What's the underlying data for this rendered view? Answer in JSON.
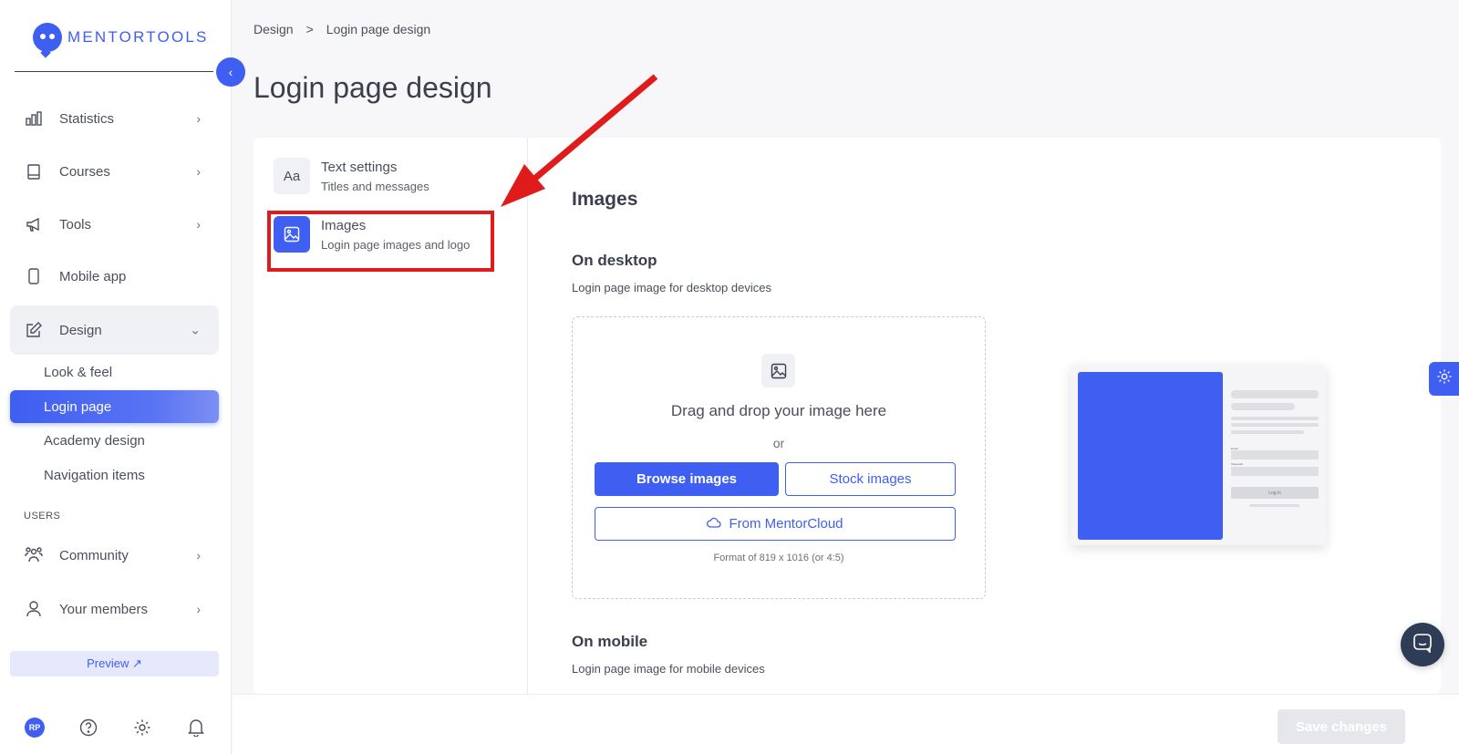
{
  "brand": {
    "name": "MENTORTOOLS",
    "accent": "#3f5ef2",
    "highlight": "#e01b1b"
  },
  "sidebar": {
    "items": [
      {
        "label": "Statistics",
        "icon": "bar-chart-icon"
      },
      {
        "label": "Courses",
        "icon": "book-icon"
      },
      {
        "label": "Tools",
        "icon": "megaphone-icon"
      },
      {
        "label": "Mobile app",
        "icon": "phone-icon"
      },
      {
        "label": "Design",
        "icon": "edit-icon"
      }
    ],
    "design_sub": [
      {
        "label": "Look & feel"
      },
      {
        "label": "Login page"
      },
      {
        "label": "Academy design"
      },
      {
        "label": "Navigation items"
      }
    ],
    "users_label": "USERS",
    "user_items": [
      {
        "label": "Community",
        "icon": "community-icon"
      },
      {
        "label": "Your members",
        "icon": "user-icon"
      }
    ],
    "preview_label": "Preview ↗",
    "avatar_initials": "RP"
  },
  "breadcrumb": {
    "parent": "Design",
    "separator": ">",
    "current": "Login page design"
  },
  "page": {
    "title": "Login page design"
  },
  "settings_menu": [
    {
      "title": "Text settings",
      "subtitle": "Titles and messages",
      "icon": "Aa"
    },
    {
      "title": "Images",
      "subtitle": "Login page images and logo",
      "icon": "image-icon"
    }
  ],
  "content": {
    "title": "Images",
    "desktop": {
      "title": "On desktop",
      "subtitle": "Login page image for desktop devices",
      "drop_text": "Drag and drop your image here",
      "or_text": "or",
      "browse_label": "Browse images",
      "stock_label": "Stock images",
      "cloud_label": "From MentorCloud",
      "format_text": "Format of 819 x 1016 (or 4:5)"
    },
    "mobile": {
      "title": "On mobile",
      "subtitle": "Login page image for mobile devices"
    },
    "preview": {
      "field1": "Email",
      "field2": "Password",
      "login": "Log in"
    }
  },
  "footer": {
    "save_label": "Save changes"
  }
}
